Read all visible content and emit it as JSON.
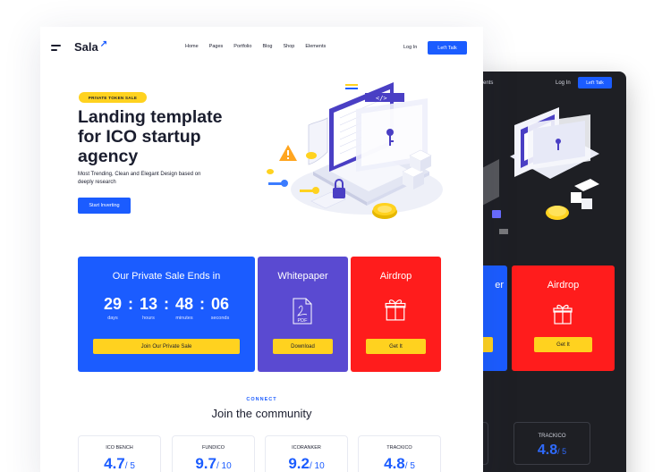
{
  "brand": {
    "name": "Sala",
    "accent": "#1b5cff",
    "yellow": "#ffd21f",
    "red": "#ff1c1c",
    "purple": "#5a4ad1"
  },
  "nav": [
    "Home",
    "Pages",
    "Portfolio",
    "Blog",
    "Shop",
    "Elements"
  ],
  "header": {
    "login": "Log In",
    "cta": "Let't Talk"
  },
  "hero": {
    "badge": "PRIVATE TOKEN SALE",
    "title": "Landing template for ICO startup agency",
    "subtitle": "Most Trending, Clean and Elegant Design based on deeply research",
    "button": "Start Inverting"
  },
  "sale": {
    "title": "Our Private Sale Ends in",
    "days": "29",
    "hours": "13",
    "minutes": "48",
    "seconds": "06",
    "days_label": "days",
    "hours_label": "hours",
    "minutes_label": "minutes",
    "seconds_label": "seconds",
    "button": "Join Our Private Sale"
  },
  "whitepaper": {
    "title": "Whitepaper",
    "button": "Download",
    "icon": "pdf-icon",
    "icon_text": "PDF"
  },
  "airdrop": {
    "title": "Airdrop",
    "button": "Get It",
    "icon": "gift-icon"
  },
  "community": {
    "eyebrow": "CONNECT",
    "title": "Join the community"
  },
  "stats": [
    {
      "name": "ICO BENCH",
      "value": "4.7",
      "max": "5"
    },
    {
      "name": "FUNDICO",
      "value": "9.7",
      "max": "10"
    },
    {
      "name": "ICORANKER",
      "value": "9.2",
      "max": "10"
    },
    {
      "name": "TRACKICO",
      "value": "4.8",
      "max": "5"
    }
  ],
  "dark": {
    "nav_partial": "ents",
    "login": "Log In",
    "cta": "Let't Talk",
    "box1_partial": "er",
    "box2_title": "Airdrop",
    "box2_button": "Get It",
    "stat_partial": "5",
    "stat_name": "TRACKICO",
    "stat_value": "4.8",
    "stat_max": "5"
  }
}
